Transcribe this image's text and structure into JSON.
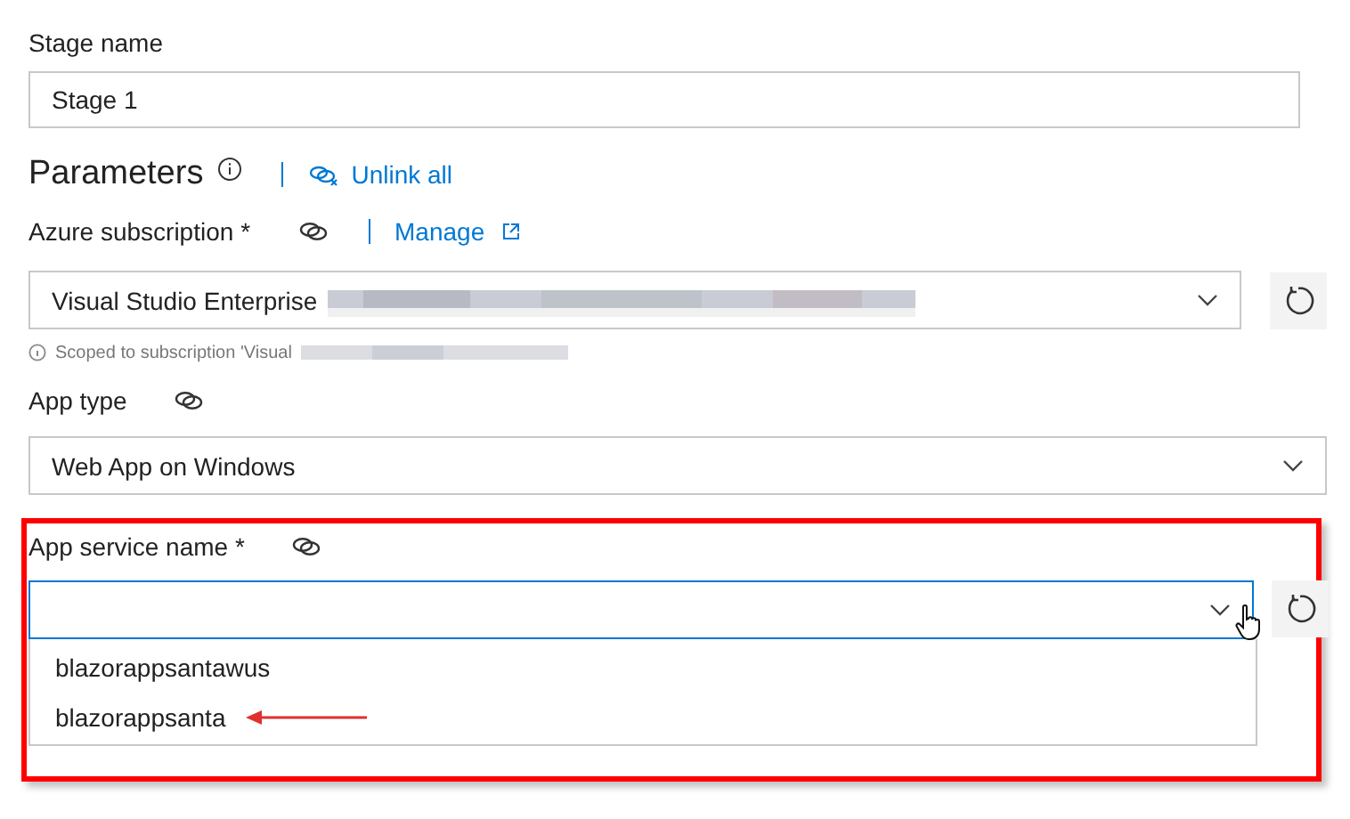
{
  "stage_name": {
    "label": "Stage name",
    "value": "Stage 1"
  },
  "parameters": {
    "title": "Parameters",
    "unlink_all": "Unlink all"
  },
  "azure_subscription": {
    "label": "Azure subscription",
    "required_mark": "*",
    "manage": "Manage",
    "value": "Visual Studio Enterprise",
    "hint": "Scoped to subscription 'Visual"
  },
  "app_type": {
    "label": "App type",
    "value": "Web App on Windows"
  },
  "app_service_name": {
    "label": "App service name",
    "required_mark": "*",
    "focused": true,
    "options": [
      {
        "label": "blazorappsantawus",
        "selected": false
      },
      {
        "label": "blazorappsanta",
        "selected": false
      }
    ]
  }
}
